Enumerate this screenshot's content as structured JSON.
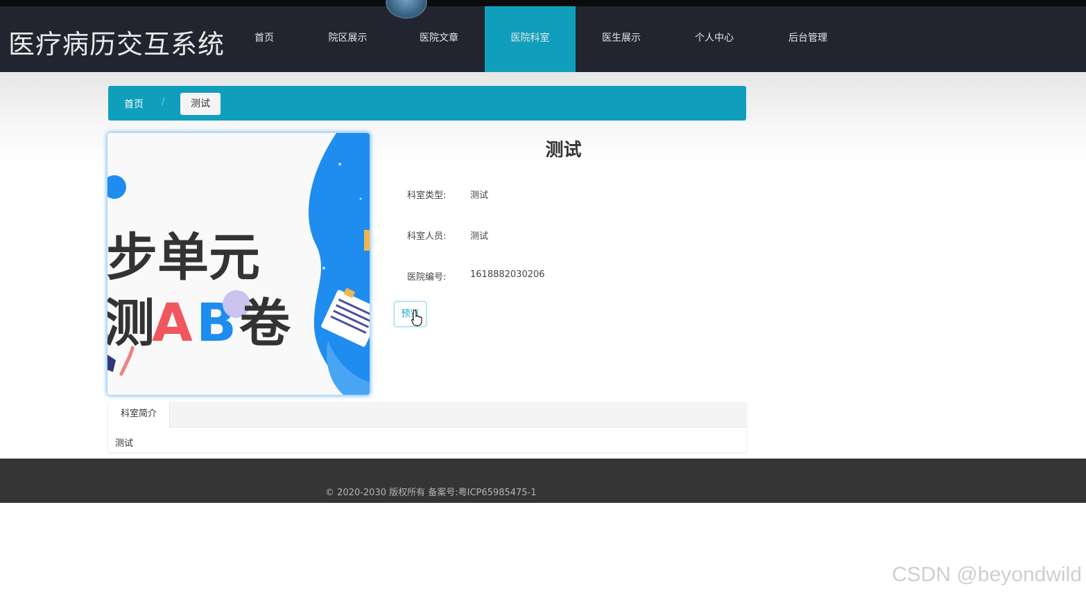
{
  "header": {
    "logo": "医疗病历交互系统",
    "nav": [
      {
        "label": "首页",
        "active": false
      },
      {
        "label": "院区展示",
        "active": false
      },
      {
        "label": "医院文章",
        "active": false
      },
      {
        "label": "医院科室",
        "active": true
      },
      {
        "label": "医生展示",
        "active": false
      },
      {
        "label": "个人中心",
        "active": false
      },
      {
        "label": "后台管理",
        "active": false
      }
    ],
    "accent_color": "#0f9fbd"
  },
  "breadcrumb": {
    "home": "首页",
    "separator": "/",
    "current": "测试"
  },
  "image": {
    "line1": "步单元",
    "line2_prefix": "测",
    "line2_a": "A",
    "line2_b": "B",
    "line2_suffix": "卷"
  },
  "detail": {
    "title": "测试",
    "fields": [
      {
        "label": "科室类型:",
        "value": "测试"
      },
      {
        "label": "科室人员:",
        "value": "测试"
      },
      {
        "label": "医院编号:",
        "value": "1618882030206"
      }
    ],
    "preview_button": "预览"
  },
  "tabs": {
    "active_label": "科室简介",
    "content": "测试"
  },
  "footer": {
    "text": "© 2020-2030 版权所有 备案号:粤ICP65985475-1"
  },
  "watermark": "CSDN @beyondwild"
}
